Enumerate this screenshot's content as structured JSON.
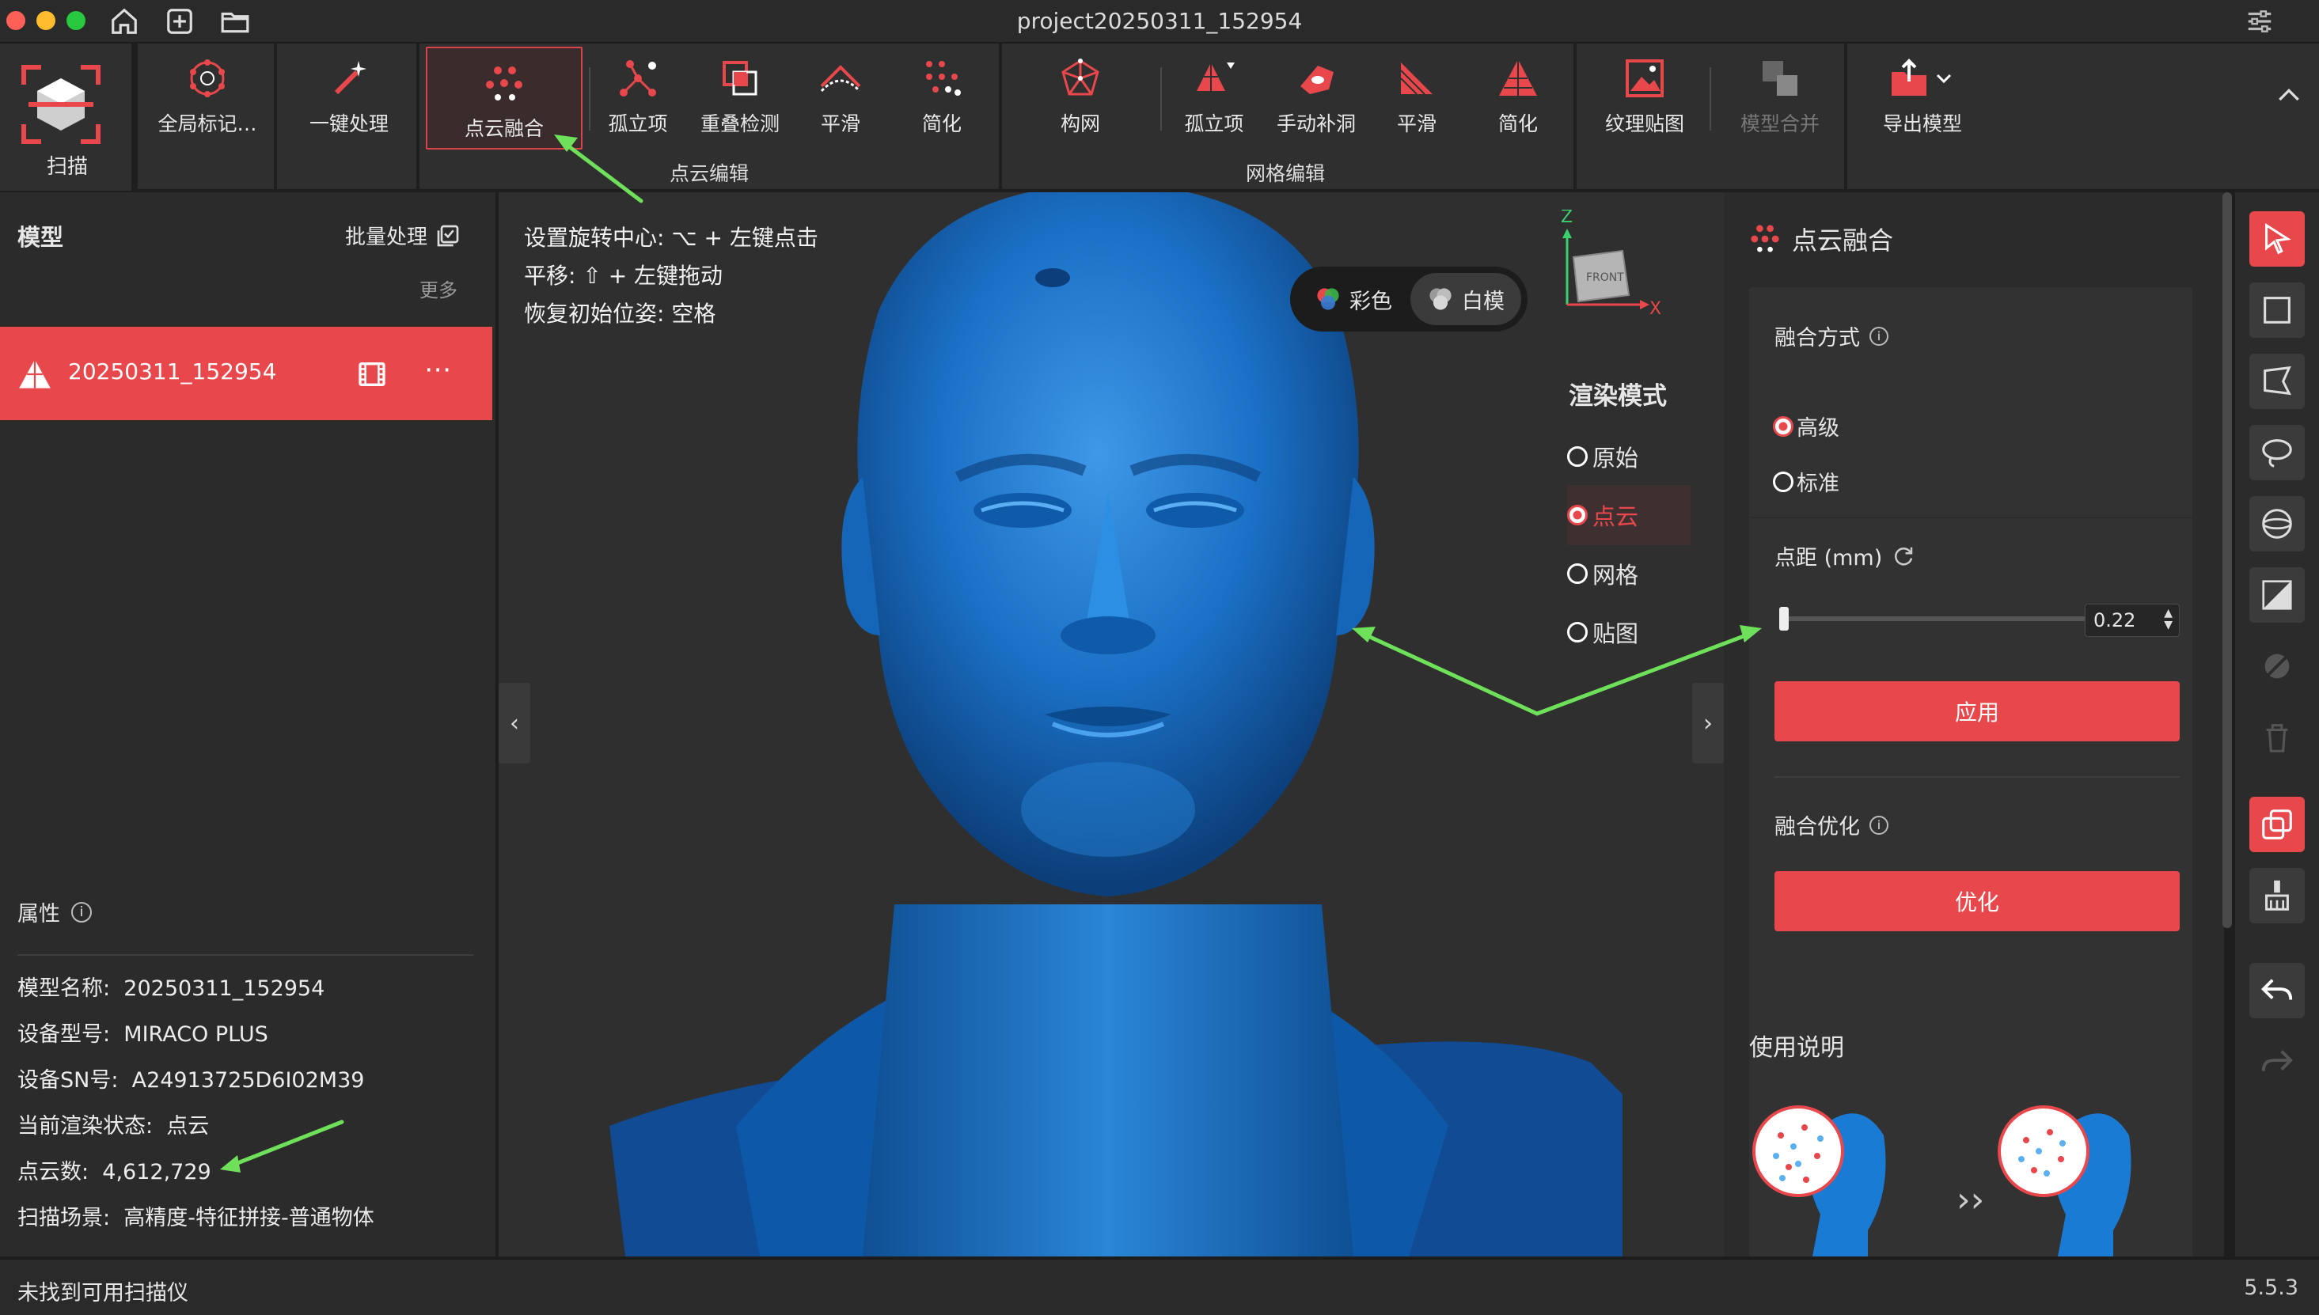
{
  "window": {
    "title": "project20250311_152954"
  },
  "toolbar": {
    "scan_label": "扫描",
    "tools": [
      {
        "label": "全局标记…",
        "icon": "global-marker-icon"
      },
      {
        "label": "一键处理",
        "icon": "magic-wand-icon"
      },
      {
        "label": "点云融合",
        "icon": "point-cloud-fusion-icon",
        "active": true
      },
      {
        "label": "孤立项",
        "icon": "isolated-points-icon"
      },
      {
        "label": "重叠检测",
        "icon": "overlap-detection-icon"
      },
      {
        "label": "平滑",
        "icon": "smooth-icon"
      },
      {
        "label": "简化",
        "icon": "simplify-icon"
      },
      {
        "label": "构网",
        "icon": "mesh-build-icon"
      },
      {
        "label": "孤立项",
        "icon": "mesh-isolated-icon"
      },
      {
        "label": "手动补洞",
        "icon": "hole-fill-icon"
      },
      {
        "label": "平滑",
        "icon": "mesh-smooth-icon"
      },
      {
        "label": "简化",
        "icon": "mesh-simplify-icon"
      },
      {
        "label": "纹理贴图",
        "icon": "texture-map-icon"
      },
      {
        "label": "模型合并",
        "icon": "model-merge-icon",
        "disabled": true
      },
      {
        "label": "导出模型",
        "icon": "export-model-icon"
      }
    ],
    "groups": {
      "point_cloud_edit": "点云编辑",
      "mesh_edit": "网格编辑"
    }
  },
  "left_panel": {
    "header": "模型",
    "batch": "批量处理",
    "more": "更多",
    "model_name": "20250311_152954",
    "properties_title": "属性",
    "properties": [
      {
        "label": "模型名称:",
        "value": "20250311_152954"
      },
      {
        "label": "设备型号:",
        "value": "MIRACO PLUS"
      },
      {
        "label": "设备SN号:",
        "value": "A24913725D6I02M39"
      },
      {
        "label": "当前渲染状态:",
        "value": "点云"
      },
      {
        "label": "点云数:",
        "value": "4,612,729"
      },
      {
        "label": "扫描场景:",
        "value": "高精度-特征拼接-普通物体"
      }
    ]
  },
  "viewport": {
    "hints": [
      "设置旋转中心: ⌥ + 左键点击",
      "平移: ⇧ + 左键拖动",
      "恢复初始位姿: 空格"
    ],
    "color_mode": {
      "color": "彩色",
      "white": "白模",
      "selected": "白模"
    },
    "render_mode_title": "渲染模式",
    "render_modes": [
      "原始",
      "点云",
      "网格",
      "贴图"
    ],
    "render_selected": "点云",
    "gizmo": {
      "z": "Z",
      "x": "X",
      "face": "FRONT"
    }
  },
  "right_panel": {
    "title": "点云融合",
    "fusion_method_label": "融合方式",
    "methods": [
      "高级",
      "标准"
    ],
    "method_selected": "高级",
    "spacing_label": "点距 (mm)",
    "spacing_value": "0.22",
    "spacing_fraction": 0.0,
    "apply": "应用",
    "optimize_label": "融合优化",
    "optimize": "优化",
    "usage_title": "使用说明"
  },
  "status": {
    "left": "未找到可用扫描仪",
    "version": "5.5.3"
  },
  "colors": {
    "accent": "#e8484b",
    "mesh_blue": "#1a6fc4",
    "arrow_green": "#6ee05a"
  }
}
